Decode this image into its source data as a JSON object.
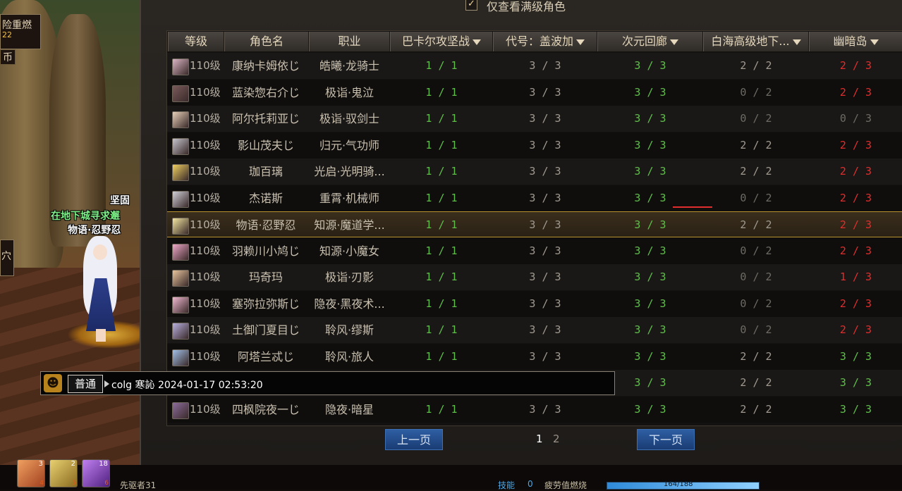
{
  "scene": {
    "top_left_line1": "险重燃",
    "top_left_line2": "22",
    "top_left_line3": "币",
    "left_tab": "穴",
    "char_prefix": "坚固",
    "char_guild": "在地下城寻求邂",
    "char_name": "物语·忍野忍"
  },
  "filter": {
    "checked": true,
    "label": "仅查看满级角色"
  },
  "columns": [
    {
      "label": "等级",
      "sortable": false
    },
    {
      "label": "角色名",
      "sortable": false
    },
    {
      "label": "职业",
      "sortable": false
    },
    {
      "label": "巴卡尔攻坚战",
      "sortable": true
    },
    {
      "label": "代号：盖波加",
      "sortable": true
    },
    {
      "label": "次元回廊",
      "sortable": true
    },
    {
      "label": "白海高级地下...",
      "sortable": true
    },
    {
      "label": "幽暗岛",
      "sortable": true
    }
  ],
  "rows": [
    {
      "level": "110级",
      "name": "康纳卡姆依じ",
      "job": "皓曦·龙骑士",
      "v": [
        "1 / 1",
        "3 / 3",
        "3 / 3",
        "2 / 2",
        "2 / 3"
      ],
      "c": [
        "green",
        "grey",
        "green",
        "grey",
        "red"
      ],
      "avatar": "#d9b4c4"
    },
    {
      "level": "110级",
      "name": "蓝染惣右介じ",
      "job": "极诣·鬼泣",
      "v": [
        "1 / 1",
        "3 / 3",
        "3 / 3",
        "0 / 2",
        "2 / 3"
      ],
      "c": [
        "green",
        "grey",
        "green",
        "dim",
        "red"
      ],
      "avatar": "#7a5a5a"
    },
    {
      "level": "110级",
      "name": "阿尔托莉亚じ",
      "job": "极诣·驭剑士",
      "v": [
        "1 / 1",
        "3 / 3",
        "3 / 3",
        "0 / 2",
        "0 / 3"
      ],
      "c": [
        "green",
        "grey",
        "green",
        "dim",
        "dim"
      ],
      "avatar": "#e8d0b8"
    },
    {
      "level": "110级",
      "name": "影山茂夫じ",
      "job": "归元·气功师",
      "v": [
        "1 / 1",
        "3 / 3",
        "3 / 3",
        "2 / 2",
        "2 / 3"
      ],
      "c": [
        "green",
        "grey",
        "green",
        "grey",
        "red"
      ],
      "avatar": "#c4c4cc"
    },
    {
      "level": "110级",
      "name": "珈百璃",
      "job": "光启·光明骑...",
      "v": [
        "1 / 1",
        "3 / 3",
        "3 / 3",
        "2 / 2",
        "2 / 3"
      ],
      "c": [
        "green",
        "grey",
        "green",
        "grey",
        "red"
      ],
      "avatar": "#f0d060"
    },
    {
      "level": "110级",
      "name": "杰诺斯",
      "job": "重霄·机械师",
      "v": [
        "1 / 1",
        "3 / 3",
        "3 / 3",
        "0 / 2",
        "2 / 3"
      ],
      "c": [
        "green",
        "grey",
        "green",
        "dim",
        "red"
      ],
      "avatar": "#d0d0d8"
    },
    {
      "level": "110级",
      "name": "物语·忍野忍",
      "job": "知源·魔道学...",
      "v": [
        "1 / 1",
        "3 / 3",
        "3 / 3",
        "2 / 2",
        "2 / 3"
      ],
      "c": [
        "green",
        "grey",
        "green",
        "grey",
        "red"
      ],
      "avatar": "#f4e6a0",
      "selected": true
    },
    {
      "level": "110级",
      "name": "羽赖川小鸠じ",
      "job": "知源·小魔女",
      "v": [
        "1 / 1",
        "3 / 3",
        "3 / 3",
        "0 / 2",
        "2 / 3"
      ],
      "c": [
        "green",
        "grey",
        "green",
        "dim",
        "red"
      ],
      "avatar": "#f0a8c8"
    },
    {
      "level": "110级",
      "name": "玛奇玛",
      "job": "极诣·刃影",
      "v": [
        "1 / 1",
        "3 / 3",
        "3 / 3",
        "0 / 2",
        "1 / 3"
      ],
      "c": [
        "green",
        "grey",
        "green",
        "dim",
        "red"
      ],
      "avatar": "#e8c49c"
    },
    {
      "level": "110级",
      "name": "塞弥拉弥斯じ",
      "job": "隐夜·黑夜术...",
      "v": [
        "1 / 1",
        "3 / 3",
        "3 / 3",
        "0 / 2",
        "2 / 3"
      ],
      "c": [
        "green",
        "grey",
        "green",
        "dim",
        "red"
      ],
      "avatar": "#f0b8d0"
    },
    {
      "level": "110级",
      "name": "土御门夏目じ",
      "job": "聆风·缪斯",
      "v": [
        "1 / 1",
        "3 / 3",
        "3 / 3",
        "0 / 2",
        "2 / 3"
      ],
      "c": [
        "green",
        "grey",
        "green",
        "dim",
        "red"
      ],
      "avatar": "#b8b0e0"
    },
    {
      "level": "110级",
      "name": "阿塔兰忒じ",
      "job": "聆风·旅人",
      "v": [
        "1 / 1",
        "3 / 3",
        "3 / 3",
        "2 / 2",
        "3 / 3"
      ],
      "c": [
        "green",
        "grey",
        "green",
        "grey",
        "green"
      ],
      "avatar": "#a0c0e8"
    },
    {
      "level": "",
      "name": "",
      "job": "",
      "v": [
        "",
        "",
        "3 / 3",
        "2 / 2",
        "3 / 3"
      ],
      "c": [
        "green",
        "grey",
        "green",
        "grey",
        "green"
      ],
      "avatar": ""
    },
    {
      "level": "110级",
      "name": "四枫院夜一じ",
      "job": "隐夜·暗星",
      "v": [
        "1 / 1",
        "3 / 3",
        "3 / 3",
        "2 / 2",
        "3 / 3"
      ],
      "c": [
        "green",
        "grey",
        "green",
        "grey",
        "green"
      ],
      "avatar": "#8c6c9c"
    }
  ],
  "pagination": {
    "prev": "上一页",
    "next": "下一页",
    "pages": [
      "1",
      "2"
    ],
    "current": "1"
  },
  "chat": {
    "emoji": "☻",
    "channel": "普通",
    "message": "colg 寒訫 2024-01-17 02:53:20"
  },
  "hud": {
    "slots": [
      {
        "num": "3",
        "key": "4",
        "color": "#e07050"
      },
      {
        "num": "2",
        "key": "5",
        "color": "#d0b050"
      },
      {
        "num": "18",
        "key": "6",
        "color": "#a050d0"
      }
    ],
    "player_label": "先驱者31",
    "skill_label": "技能",
    "skill_points": "0",
    "fatigue_label": "疲劳值燃烧",
    "bar_value": "164/188"
  }
}
